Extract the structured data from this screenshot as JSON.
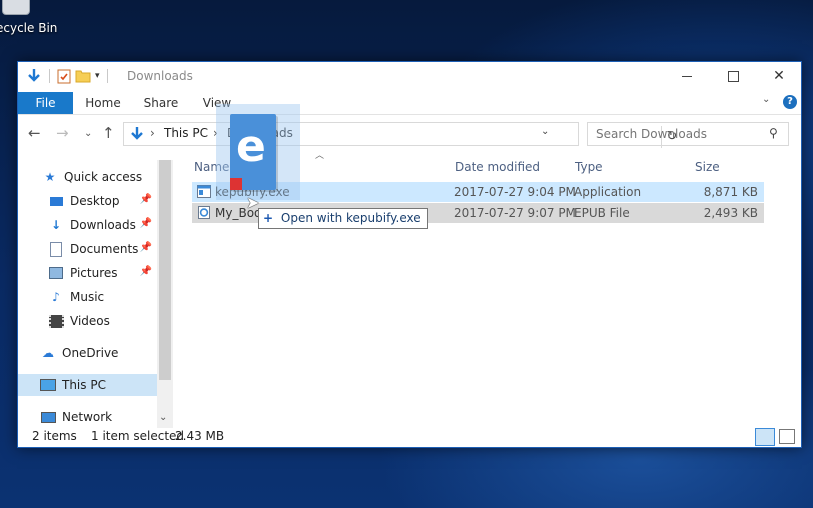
{
  "desktop": {
    "recycle_bin_label": "ecycle Bin"
  },
  "window": {
    "title": "Downloads"
  },
  "ribbon": {
    "tabs": [
      "File",
      "Home",
      "Share",
      "View"
    ],
    "help": "?"
  },
  "address": {
    "crumbs": [
      "This PC",
      "Downloads"
    ]
  },
  "search": {
    "placeholder": "Search Downloads"
  },
  "sidebar": {
    "items": [
      {
        "label": "Quick access",
        "icon": "star-icon",
        "pinned": false
      },
      {
        "label": "Desktop",
        "icon": "desktop-icon",
        "pinned": true
      },
      {
        "label": "Downloads",
        "icon": "download-arrow-icon",
        "pinned": true
      },
      {
        "label": "Documents",
        "icon": "document-icon",
        "pinned": true
      },
      {
        "label": "Pictures",
        "icon": "picture-icon",
        "pinned": true
      },
      {
        "label": "Music",
        "icon": "music-note-icon",
        "pinned": false
      },
      {
        "label": "Videos",
        "icon": "film-icon",
        "pinned": false
      },
      {
        "label": "OneDrive",
        "icon": "cloud-icon",
        "pinned": false
      },
      {
        "label": "This PC",
        "icon": "computer-icon",
        "pinned": false
      },
      {
        "label": "Network",
        "icon": "network-icon",
        "pinned": false
      }
    ]
  },
  "columns": {
    "name": "Name",
    "date": "Date modified",
    "type": "Type",
    "size": "Size"
  },
  "files": [
    {
      "name": "kepubify.exe",
      "date": "2017-07-27 9:04 PM",
      "type": "Application",
      "size": "8,871 KB"
    },
    {
      "name": "My_Boo",
      "date": "2017-07-27 9:07 PM",
      "type": "EPUB File",
      "size": "2,493 KB"
    }
  ],
  "drag": {
    "tooltip": "Open with kepubify.exe",
    "plus": "+",
    "letter": "e"
  },
  "status": {
    "count": "2 items",
    "selected": "1 item selected",
    "size": "2.43 MB"
  },
  "colors": {
    "accent": "#1979ca",
    "selection": "#cce8ff",
    "drag_row": "#d9d9d9"
  }
}
